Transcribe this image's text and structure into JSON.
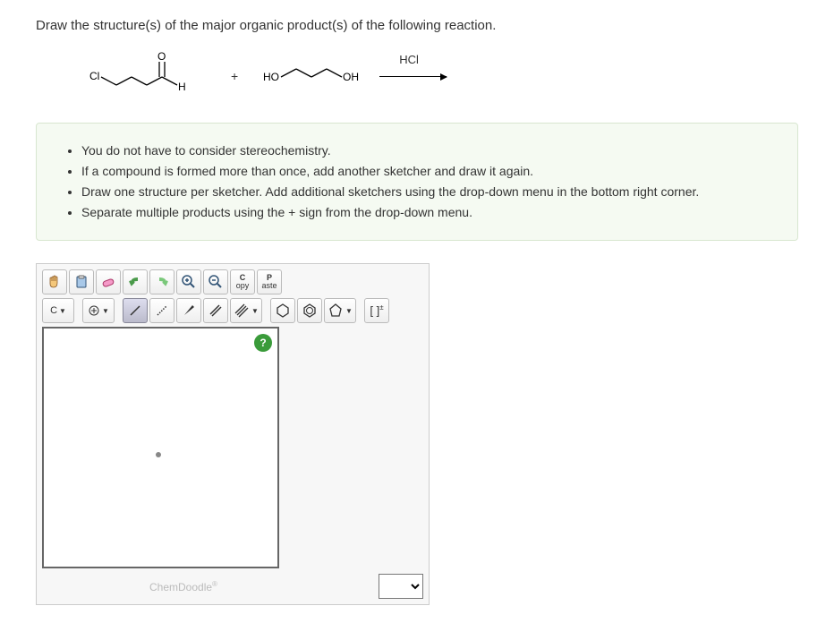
{
  "question": "Draw the structure(s) of the major organic product(s) of the following reaction.",
  "reagent": "HCl",
  "instructions": [
    "You do not have to consider stereochemistry.",
    "If a compound is formed more than once, add another sketcher and draw it again.",
    "Draw one structure per sketcher. Add additional sketchers using the drop-down menu in the bottom right corner.",
    "Separate multiple products using the + sign from the drop-down menu."
  ],
  "toolbar1": {
    "copy": "Copy",
    "paste": "Paste"
  },
  "toolbar2": {
    "element": "C"
  },
  "brand": "ChemDoodle",
  "help": "?"
}
